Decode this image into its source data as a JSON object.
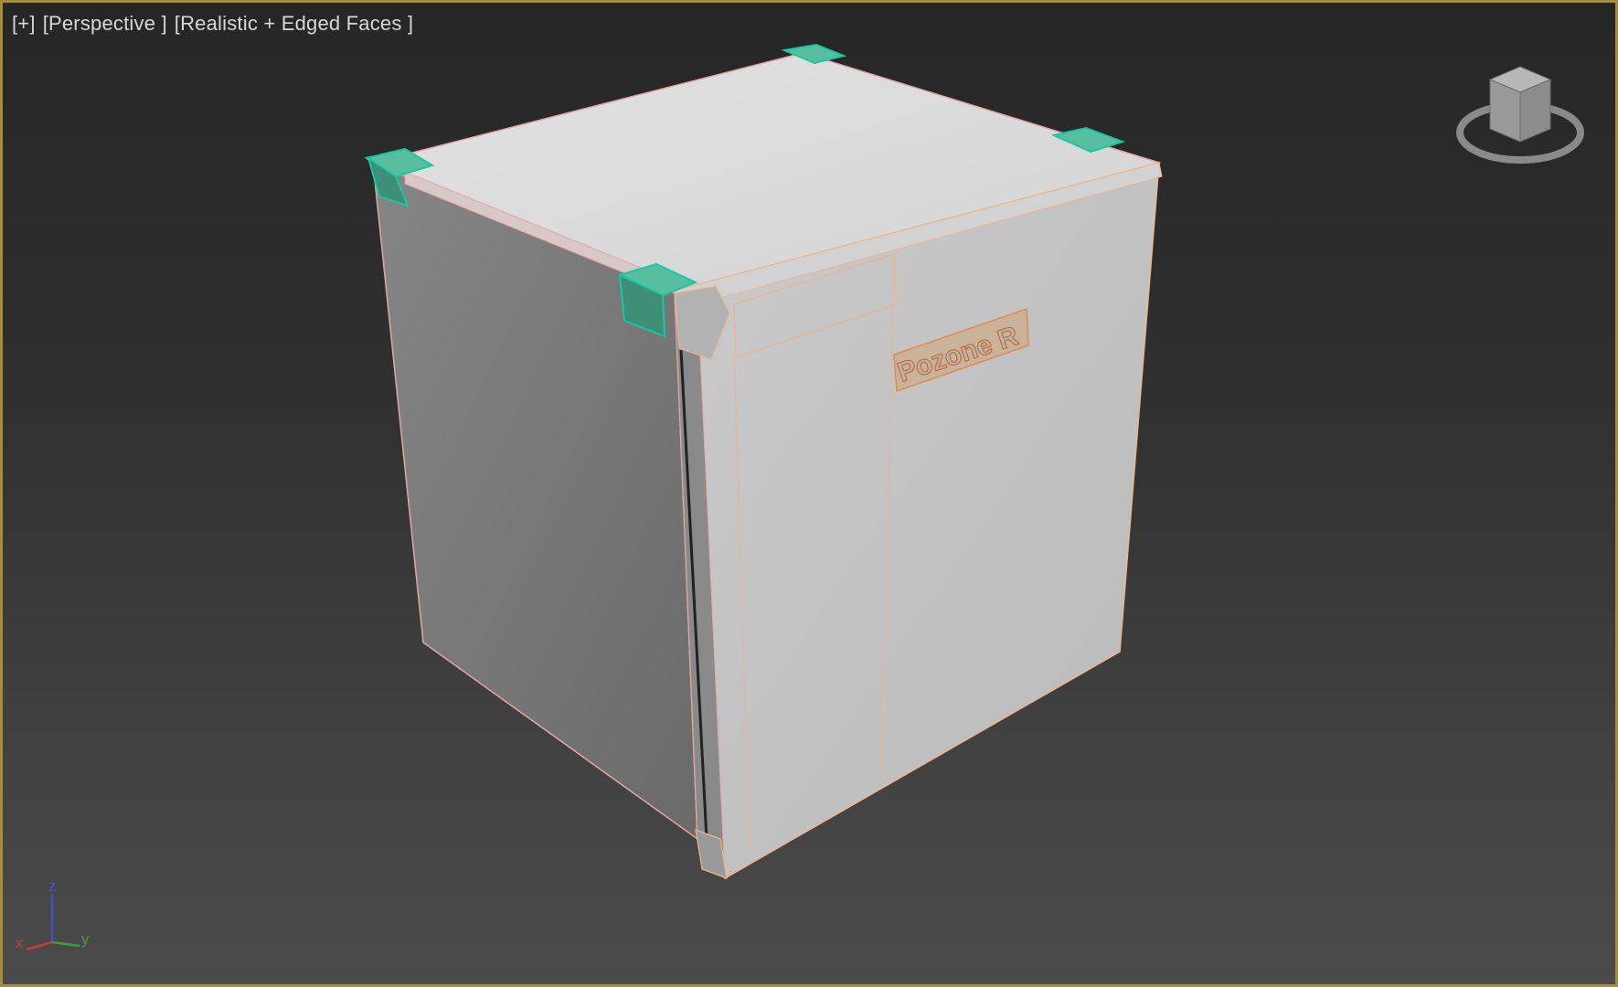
{
  "viewport": {
    "labels": [
      {
        "name": "viewport-menu-label",
        "text": "[+]"
      },
      {
        "name": "viewport-pov-label",
        "text": "[Perspective ]"
      },
      {
        "name": "viewport-shading-label",
        "text": "[Realistic + Edged Faces ]"
      }
    ],
    "border_color": "#a58d3c"
  },
  "model": {
    "logo_text": "Pozone R"
  },
  "axis_tripod": {
    "x_label": "x",
    "y_label": "y",
    "z_label": "z",
    "x_color": "#c83c3c",
    "y_color": "#3ca03c",
    "z_color": "#4050c8"
  },
  "icons": {
    "viewcube": "viewcube-icon",
    "axis": "axis-tripod-icon"
  }
}
